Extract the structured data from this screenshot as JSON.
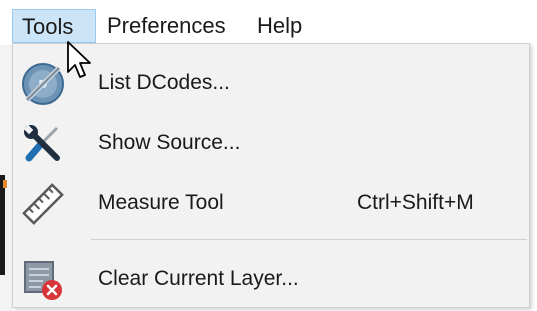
{
  "menubar": {
    "items": [
      {
        "label": "Tools",
        "active": true
      },
      {
        "label": "Preferences",
        "active": false
      },
      {
        "label": "Help",
        "active": false
      }
    ]
  },
  "tools_menu": {
    "items": [
      {
        "label": "List DCodes...",
        "shortcut": "",
        "icon": "dcodes-icon"
      },
      {
        "label": "Show Source...",
        "shortcut": "",
        "icon": "wrench-screwdriver-icon"
      },
      {
        "label": "Measure Tool",
        "shortcut": "Ctrl+Shift+M",
        "icon": "ruler-icon"
      },
      {
        "label": "Clear Current Layer...",
        "shortcut": "",
        "icon": "clear-layer-icon"
      }
    ]
  },
  "colors": {
    "menubar_active_bg": "#cce4f7",
    "menubar_active_border": "#99c9ef",
    "dropdown_bg": "#f2f2f2",
    "text": "#1a1a1a",
    "icon_blue": "#1f6fb2",
    "icon_red": "#d9343a"
  }
}
